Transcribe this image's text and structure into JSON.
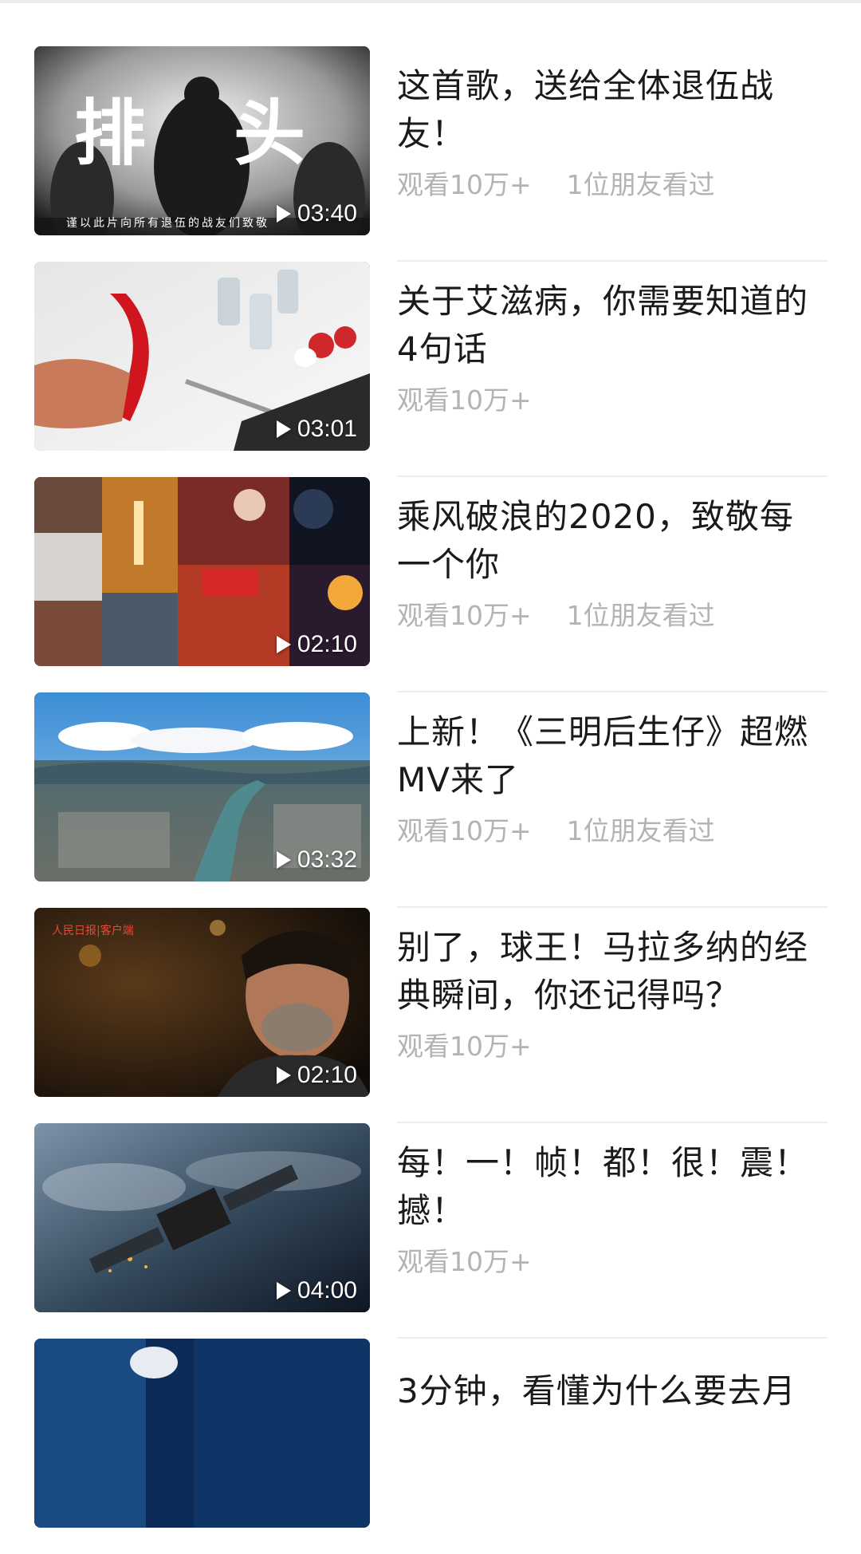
{
  "feed": {
    "items": [
      {
        "title": "这首歌，送给全体退伍战友！",
        "views": "观看10万+",
        "friends": "1位朋友看过",
        "duration": "03:40",
        "thumb_caption": "谨以此片向所有退伍的战友们致敬",
        "thumb_overlay": "排头",
        "thumb_theme": "smoke-soldiers"
      },
      {
        "title": "关于艾滋病，你需要知道的4句话",
        "views": "观看10万+",
        "friends": "",
        "duration": "03:01",
        "thumb_theme": "red-ribbon-medicine"
      },
      {
        "title": "乘风破浪的2020，致敬每一个你",
        "views": "观看10万+",
        "friends": "1位朋友看过",
        "duration": "02:10",
        "thumb_theme": "collage-2020"
      },
      {
        "title": "上新！《三明后生仔》超燃MV来了",
        "views": "观看10万+",
        "friends": "1位朋友看过",
        "duration": "03:32",
        "thumb_theme": "city-aerial"
      },
      {
        "title": "别了，球王！马拉多纳的经典瞬间，你还记得吗？",
        "views": "观看10万+",
        "friends": "",
        "duration": "02:10",
        "thumb_caption": "人民日报|客户端",
        "thumb_theme": "portrait-dark"
      },
      {
        "title": "每！一！帧！都！很！震！撼！",
        "views": "观看10万+",
        "friends": "",
        "duration": "04:00",
        "thumb_theme": "satellite-earth"
      },
      {
        "title": "3分钟，看懂为什么要去月",
        "views": "",
        "friends": "",
        "duration": "",
        "thumb_theme": "space-partial"
      }
    ]
  },
  "colors": {
    "title": "#1a1a1a",
    "meta": "#b3b3b3",
    "divider": "#eeeeee",
    "background": "#ffffff"
  }
}
